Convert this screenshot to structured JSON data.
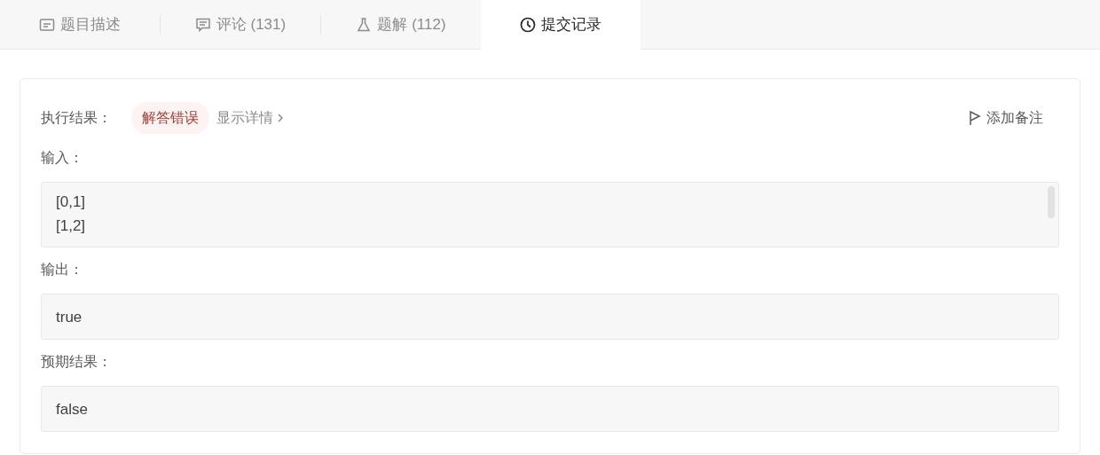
{
  "tabs": [
    {
      "label": "题目描述",
      "kind": "description",
      "selected": false
    },
    {
      "label": "评论 (131)",
      "kind": "comment",
      "selected": false
    },
    {
      "label": "题解 (112)",
      "kind": "flask",
      "selected": false
    },
    {
      "label": "提交记录",
      "kind": "clock",
      "selected": true
    }
  ],
  "result": {
    "label": "执行结果：",
    "status": "解答错误",
    "details_link": "显示详情",
    "add_note": "添加备注"
  },
  "sections": [
    {
      "label": "输入：",
      "lines": [
        "[0,1]",
        "[1,2]"
      ],
      "scrollable": true
    },
    {
      "label": "输出：",
      "lines": [
        "true"
      ],
      "scrollable": false
    },
    {
      "label": "预期结果：",
      "lines": [
        "false"
      ],
      "scrollable": false
    }
  ]
}
